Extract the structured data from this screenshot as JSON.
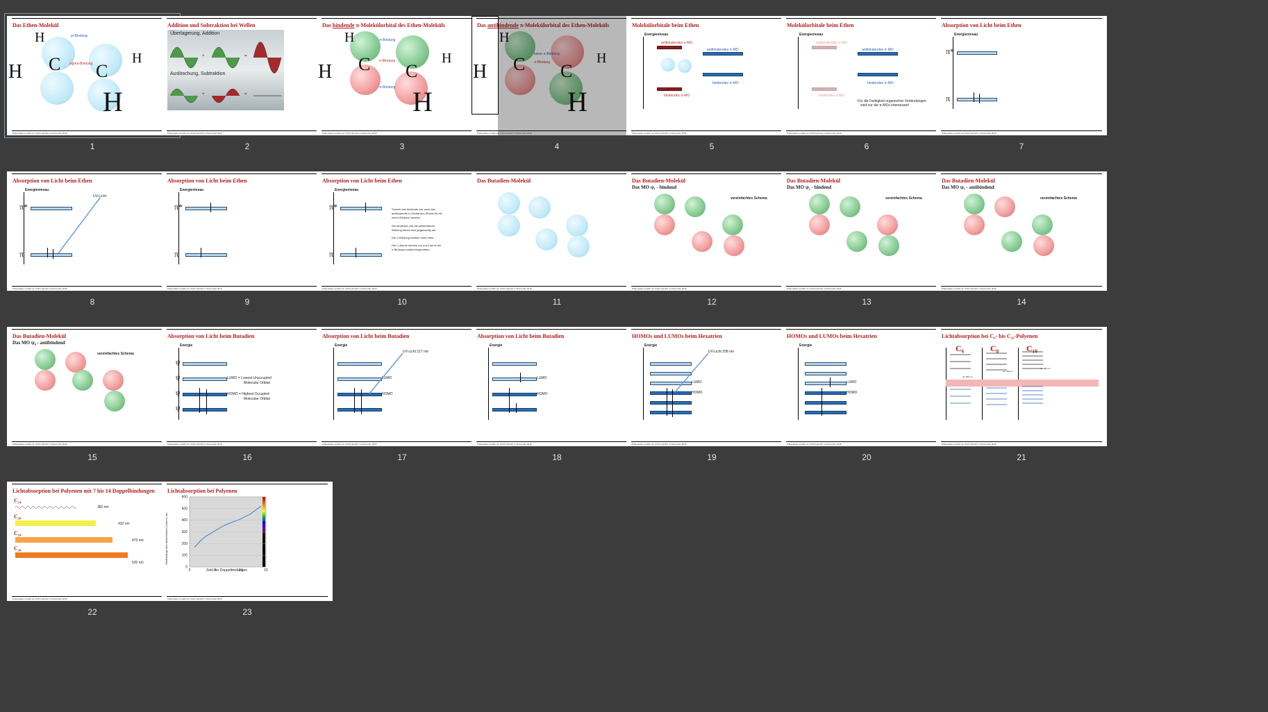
{
  "slides": [
    {
      "num": "1",
      "title": "Das Ethen-Molekül",
      "labels": [
        "pi-Bindung",
        "sigma-Bindung"
      ],
      "atoms": [
        "H",
        "C",
        "C",
        "H",
        "H",
        "H"
      ]
    },
    {
      "num": "2",
      "title": "Addition und Subtraktion bei Wellen",
      "labels": [
        "Überlagerung, Addition",
        "Auslöschung, Subtraktion",
        "+",
        "=",
        "+",
        "="
      ]
    },
    {
      "num": "3",
      "title_prefix": "Das ",
      "title_u": "bindende",
      "title_suffix": " π-Molekülorbital des Ethen-Moleküls",
      "labels": [
        "π-Bindung",
        "σ-Bindung",
        "π-Bindung"
      ],
      "atoms": [
        "H",
        "C",
        "C",
        "H",
        "H",
        "H"
      ]
    },
    {
      "num": "4",
      "title_prefix": "Das ",
      "title_u": "antibindende",
      "title_suffix": " π-Molekülorbital des Ethen-Moleküls",
      "labels": [
        "keine π-Bindung",
        "σ-Bindung"
      ],
      "atoms": [
        "H",
        "C",
        "C",
        "H",
        "H",
        "H"
      ]
    },
    {
      "num": "5",
      "title": "Molekülorbitale beim Ethen",
      "labels": [
        "Energieniveau",
        "antibindendes σ-MO",
        "antibindendes π-MO",
        "bindendes π-MO",
        "bindendes σ-MO"
      ]
    },
    {
      "num": "6",
      "title": "Molekülorbitale beim Ethen",
      "labels": [
        "Energieniveau",
        "antibindendes σ-MO",
        "antibindendes π-MO",
        "bindendes π-MO",
        "bindendes σ-MO",
        "Für die Farbigkeit organischer Verbindungen",
        "sind nur die π-MOs interessant!"
      ]
    },
    {
      "num": "7",
      "title": "Absorption von Licht beim Ethen",
      "labels": [
        "Energieniveau",
        "π*",
        "π"
      ]
    },
    {
      "num": "8",
      "title": "Absorption von Licht beim Ethen",
      "labels": [
        "Energieniveau",
        "π*",
        "π",
        "UV-Licht"
      ]
    },
    {
      "num": "9",
      "title": "Absorption von Licht beim Ethen",
      "labels": [
        "Energieniveau",
        "π*",
        "π"
      ]
    },
    {
      "num": "10",
      "title": "Absorption von Licht beim Ethen",
      "labels": [
        "Energieniveau",
        "π*",
        "π"
      ],
      "text": [
        "Sowohl das bindende wie auch das",
        "antibindende π-Orbital des Ethens ist mit",
        "einem Elektron besetzt.",
        "Die bindende und die antibindende",
        "Wirkung heben sich gegenseitig auf.",
        "Die π-Bindung existiert nicht mehr.",
        "Die C-Atome werden nur noch durch die",
        "σ-Bindung zusammengehalten."
      ]
    },
    {
      "num": "11",
      "title": "Das Butadien-Molekül"
    },
    {
      "num": "12",
      "title": "Das Butadien-Molekül",
      "subtitle": "Das MO ψ₁ - bindend",
      "schema": "vereinfachtes Schema"
    },
    {
      "num": "13",
      "title": "Das Butadien-Molekül",
      "subtitle": "Das MO ψ₂ - bindend",
      "schema": "vereinfachtes Schema"
    },
    {
      "num": "14",
      "title": "Das Butadien-Molekül",
      "subtitle": "Das MO ψ₃ - antibindend",
      "schema": "vereinfachtes Schema"
    },
    {
      "num": "15",
      "title": "Das Butadien-Molekül",
      "subtitle": "Das MO ψ₄ - antibindend",
      "schema": "vereinfachtes Schema"
    },
    {
      "num": "16",
      "title": "Absorption von Licht beim Butadien",
      "labels": [
        "Energie",
        "ψ",
        "ψ",
        "ψ",
        "ψ",
        "LUMO = Lowest Unoccupied",
        "Molecular Orbital",
        "HOMO = Highest Occupied",
        "Molecular Orbital"
      ]
    },
    {
      "num": "17",
      "title": "Absorption von Licht beim Butadien",
      "labels": [
        "Energie",
        "UV-Licht 217 nm",
        "LUMO",
        "HOMO"
      ]
    },
    {
      "num": "18",
      "title": "Absorption von Licht beim Butadien",
      "labels": [
        "Energie",
        "LUMO",
        "HOMO"
      ]
    },
    {
      "num": "19",
      "title": "HOMOs und LUMOs beim Hexatrien",
      "labels": [
        "Energie",
        "UV-Licht 258 nm",
        "LUMO",
        "HOMO"
      ]
    },
    {
      "num": "20",
      "title": "HOMOs und LUMOs beim Hexatrien",
      "labels": [
        "Energie",
        "LUMO",
        "HOMO"
      ]
    },
    {
      "num": "21",
      "title": "Lichtabsorption bei C₆- bis C₁₀-Polyenen",
      "labels": [
        "C₆",
        "C₈",
        "C₁₀",
        "ca. 290 nm",
        "ca. 340 nm",
        "ca. 380 nm"
      ]
    },
    {
      "num": "22",
      "title": "Lichtabsorption bei Polyenen mit 7 bis 14 Doppelbindungen",
      "labels": [
        "C₁₄",
        "C₂₀",
        "C₂₄",
        "C₂₈",
        "382 nm",
        "432 nm",
        "473 nm",
        "520 nm"
      ]
    },
    {
      "num": "23",
      "title": "Lichtabsorption bei Polyenen",
      "xlabel": "Zahl der Doppelbindungen",
      "ylabel": "Wellenlänge des absorbierten Lichts in nm"
    }
  ],
  "footer": "Präsentation erstellt von Ulrich Helmich im Dezember 2016",
  "chart_data": {
    "type": "line",
    "title": "Lichtabsorption bei Polyenen",
    "xlabel": "Zahl der Doppelbindungen",
    "ylabel": "Wellenlänge des absorbierten Lichts in nm",
    "xlim": [
      0,
      15
    ],
    "ylim": [
      0,
      600
    ],
    "xticks": [
      "0",
      "5",
      "10",
      "15"
    ],
    "yticks": [
      "0",
      "100",
      "200",
      "300",
      "400",
      "500",
      "600"
    ],
    "x": [
      1,
      2,
      3,
      5,
      7,
      10,
      12,
      14
    ],
    "y": [
      170,
      217,
      258,
      310,
      360,
      410,
      455,
      520
    ]
  }
}
